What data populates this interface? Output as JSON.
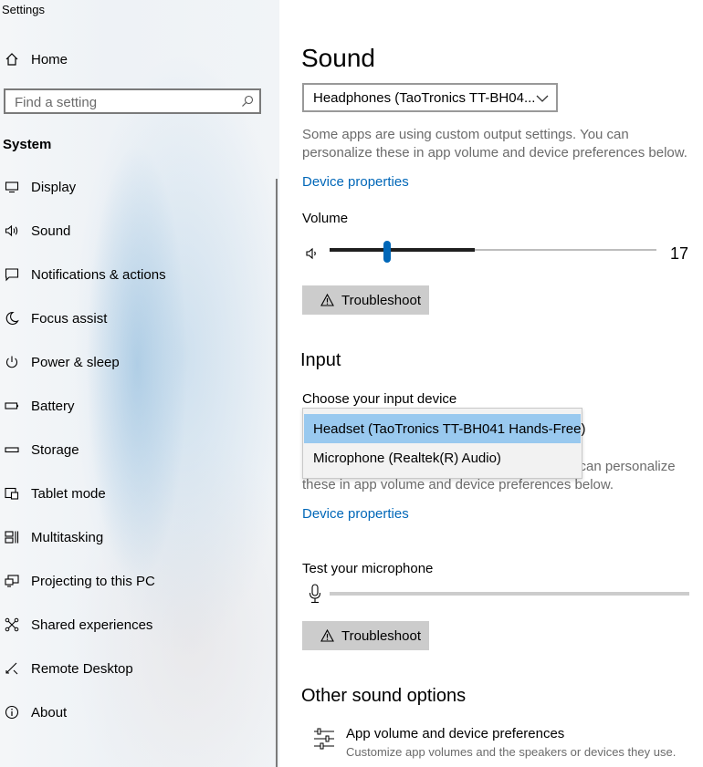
{
  "window": {
    "title": "Settings"
  },
  "sidebar": {
    "home_label": "Home",
    "search_placeholder": "Find a setting",
    "section_title": "System",
    "items": [
      {
        "label": "Display",
        "icon": "monitor-icon"
      },
      {
        "label": "Sound",
        "icon": "speaker-icon"
      },
      {
        "label": "Notifications & actions",
        "icon": "notification-icon"
      },
      {
        "label": "Focus assist",
        "icon": "moon-icon"
      },
      {
        "label": "Power & sleep",
        "icon": "power-icon"
      },
      {
        "label": "Battery",
        "icon": "battery-icon"
      },
      {
        "label": "Storage",
        "icon": "storage-icon"
      },
      {
        "label": "Tablet mode",
        "icon": "tablet-icon"
      },
      {
        "label": "Multitasking",
        "icon": "multitasking-icon"
      },
      {
        "label": "Projecting to this PC",
        "icon": "projecting-icon"
      },
      {
        "label": "Shared experiences",
        "icon": "shared-icon"
      },
      {
        "label": "Remote Desktop",
        "icon": "remote-desktop-icon"
      },
      {
        "label": "About",
        "icon": "info-icon"
      }
    ]
  },
  "main": {
    "title": "Sound",
    "output": {
      "device": "Headphones (TaoTronics TT-BH04...",
      "description": "Some apps are using custom output settings. You can personalize these in app volume and device preferences below.",
      "device_properties": "Device properties",
      "volume_label": "Volume",
      "volume_value": "17",
      "volume_level": 0.17,
      "troubleshoot": "Troubleshoot"
    },
    "input": {
      "section_title": "Input",
      "choose_label": "Choose your input device",
      "options": [
        "Headset (TaoTronics TT-BH041 Hands-Free)",
        "Microphone (Realtek(R) Audio)"
      ],
      "selected_index": 0,
      "description_line1_visible": "u can personalize",
      "description_line2": "these in app volume and device preferences below.",
      "device_properties": "Device properties",
      "test_mic_label": "Test your microphone",
      "mic_level": 0,
      "troubleshoot": "Troubleshoot"
    },
    "other": {
      "section_title": "Other sound options",
      "app_volume_title": "App volume and device preferences",
      "app_volume_subtitle": "Customize app volumes and the speakers or devices they use."
    }
  },
  "colors": {
    "accent": "#0067b8",
    "link": "#0067b8",
    "button_bg": "#cccccc",
    "selected_option": "#99c9ef"
  }
}
